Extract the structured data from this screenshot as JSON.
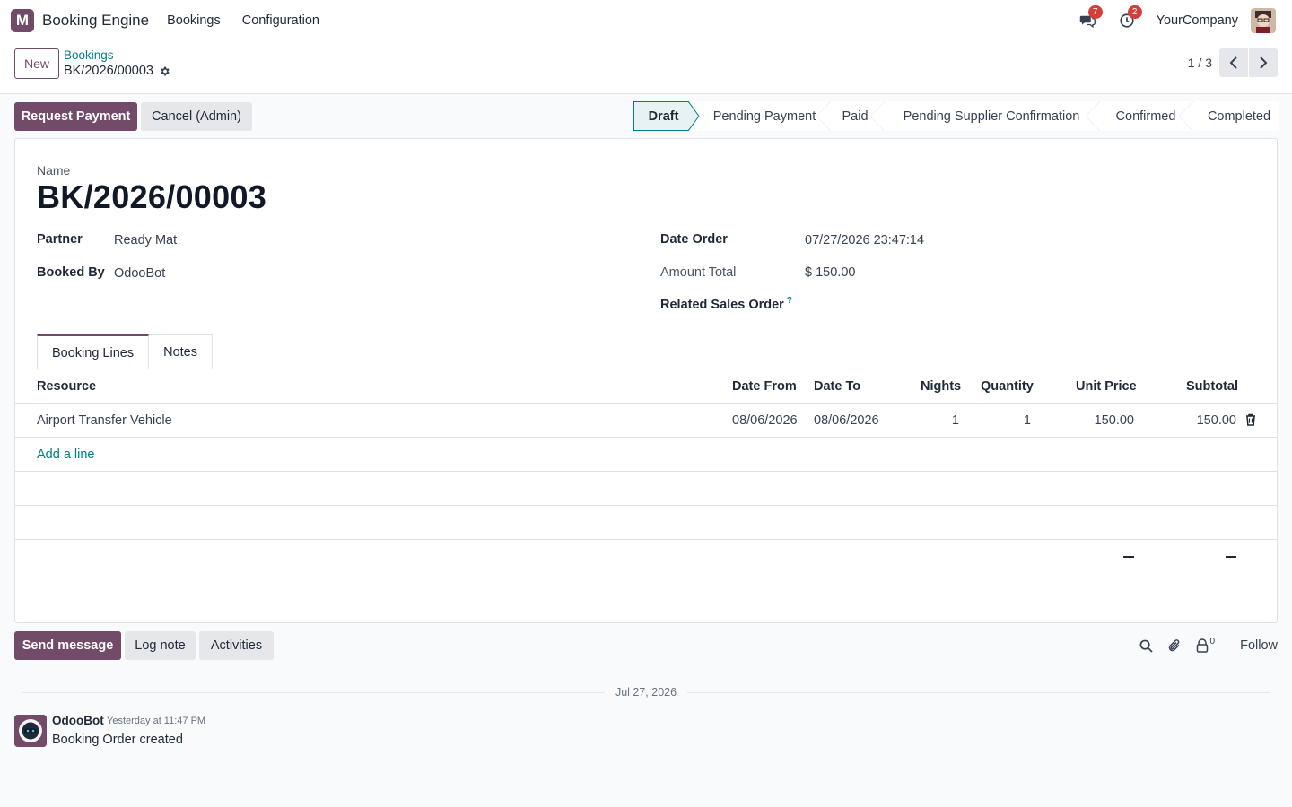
{
  "navbar": {
    "logo_letter": "M",
    "app_name": "Booking Engine",
    "menus": [
      "Bookings",
      "Configuration"
    ],
    "messages_count": "7",
    "activities_count": "2",
    "company": "YourCompany"
  },
  "control": {
    "new_label": "New",
    "breadcrumb": "Bookings",
    "record_name": "BK/2026/00003",
    "pager": "1 / 3"
  },
  "header": {
    "request_payment": "Request Payment",
    "cancel_admin": "Cancel (Admin)",
    "stages": [
      "Draft",
      "Pending Payment",
      "Paid",
      "Pending Supplier Confirmation",
      "Confirmed",
      "Completed"
    ],
    "active_stage": "Draft"
  },
  "form": {
    "name_label": "Name",
    "name": "BK/2026/00003",
    "partner_label": "Partner",
    "partner": "Ready Mat",
    "booked_by_label": "Booked By",
    "booked_by": "OdooBot",
    "date_order_label": "Date Order",
    "date_order": "07/27/2026 23:47:14",
    "amount_total_label": "Amount Total",
    "amount_total": "$ 150.00",
    "related_so_label": "Related Sales Order",
    "related_so_help": "?"
  },
  "tabs": [
    "Booking Lines",
    "Notes"
  ],
  "lines": {
    "columns": [
      "Resource",
      "Date From",
      "Date To",
      "Nights",
      "Quantity",
      "Unit Price",
      "Subtotal"
    ],
    "rows": [
      {
        "resource": "Airport Transfer Vehicle",
        "date_from": "08/06/2026",
        "date_to": "08/06/2026",
        "nights": "1",
        "quantity": "1",
        "unit_price": "150.00",
        "subtotal": "150.00"
      }
    ],
    "add_line": "Add a line"
  },
  "chatter": {
    "send_message": "Send message",
    "log_note": "Log note",
    "activities": "Activities",
    "followers_count": "0",
    "follow": "Follow",
    "date_separator": "Jul 27, 2026",
    "message": {
      "author": "OdooBot",
      "time": "Yesterday at 11:47 PM",
      "body": "Booking Order created"
    }
  },
  "colors": {
    "brand": "#714b67",
    "link": "#017e84",
    "badge": "#d23f3a"
  }
}
